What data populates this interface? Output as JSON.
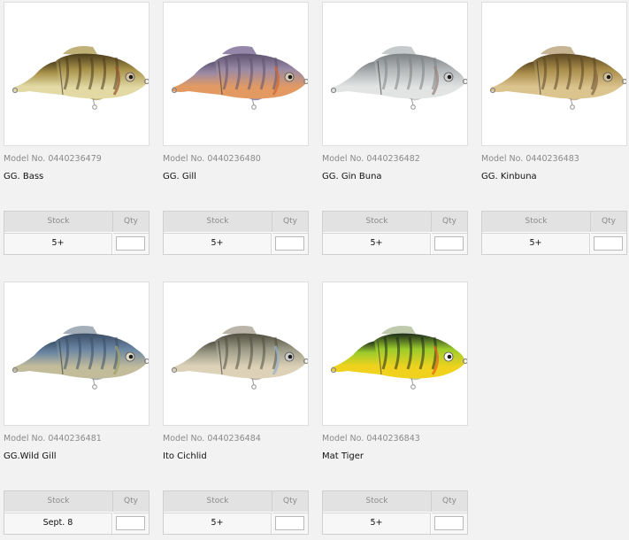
{
  "labels": {
    "stock_header": "Stock",
    "qty_header": "Qty"
  },
  "products": [
    {
      "model": "Model No. 0440236479",
      "name": "GG. Bass",
      "stock": "5+",
      "body": "#a8924a",
      "belly": "#e2d9a4",
      "stripe": "#4a3c1c",
      "fin": "#b9a96a",
      "accent": "#9a5a32",
      "eye": "#d8c2a0"
    },
    {
      "model": "Model No. 0440236480",
      "name": "GG. Gill",
      "stock": "5+",
      "body": "#9a8aa6",
      "belly": "#e39a62",
      "stripe": "#5d5270",
      "fin": "#8a7aa0",
      "accent": "#cf6a36",
      "eye": "#d8c8b0"
    },
    {
      "model": "Model No. 0440236482",
      "name": "GG. Gin Buna",
      "stock": "5+",
      "body": "#b2b6b8",
      "belly": "#e2e4e3",
      "stripe": "#7c8184",
      "fin": "#c0c4c4",
      "accent": "#9a8680",
      "eye": "#d0d0d0"
    },
    {
      "model": "Model No. 0440236483",
      "name": "GG. Kinbuna",
      "stock": "5+",
      "body": "#a88c4a",
      "belly": "#dcc48e",
      "stripe": "#5a4622",
      "fin": "#c0ac86",
      "accent": "#8a6a44",
      "eye": "#d8c29a"
    },
    {
      "model": "Model No. 0440236481",
      "name": "GG.Wild Gill",
      "stock": "Sept. 8",
      "body": "#6a86a4",
      "belly": "#c2bc9a",
      "stripe": "#3c4e66",
      "fin": "#9aa6b2",
      "accent": "#a2a26a",
      "eye": "#e0dcc8"
    },
    {
      "model": "Model No. 0440236484",
      "name": "Ito Cichlid",
      "stock": "5+",
      "body": "#9a9a86",
      "belly": "#ddd2b8",
      "stripe": "#514e40",
      "fin": "#b2aca0",
      "accent": "#9ab4cc",
      "eye": "#cfcfcf"
    },
    {
      "model": "Model No. 0440236843",
      "name": "Mat Tiger",
      "stock": "5+",
      "body": "#9ccc2c",
      "belly": "#f0d21e",
      "stripe": "#1c2a1c",
      "fin": "#b8c4a4",
      "accent": "#e46a1c",
      "eye": "#ffffff"
    }
  ]
}
